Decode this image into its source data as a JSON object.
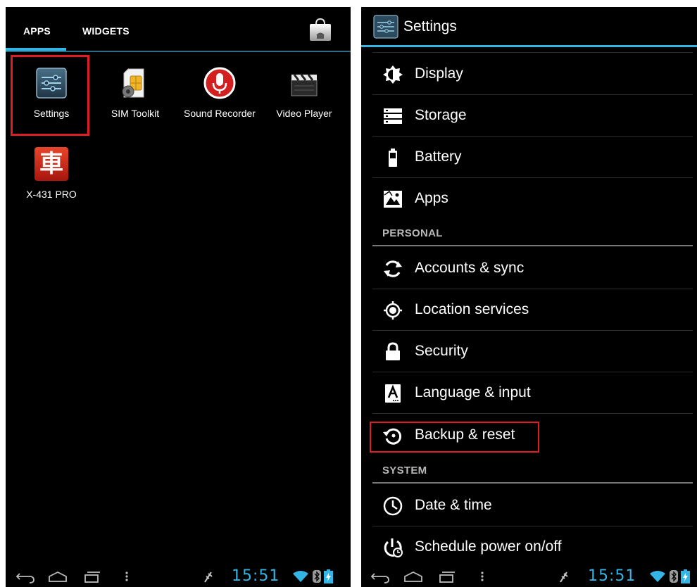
{
  "app_drawer": {
    "tabs": [
      {
        "label": "APPS"
      },
      {
        "label": "WIDGETS"
      }
    ],
    "apps": [
      {
        "label": "Settings"
      },
      {
        "label": "SIM Toolkit"
      },
      {
        "label": "Sound Recorder"
      },
      {
        "label": "Video Player"
      },
      {
        "label": "X-431 PRO"
      }
    ],
    "x431_glyph": "車"
  },
  "settings": {
    "title": "Settings",
    "items_top": [
      {
        "label": "Display",
        "icon": "display-icon"
      },
      {
        "label": "Storage",
        "icon": "storage-icon"
      },
      {
        "label": "Battery",
        "icon": "battery-icon"
      },
      {
        "label": "Apps",
        "icon": "apps-icon"
      }
    ],
    "sections": [
      {
        "header": "PERSONAL",
        "items": [
          {
            "label": "Accounts & sync",
            "icon": "sync-icon"
          },
          {
            "label": "Location services",
            "icon": "location-icon"
          },
          {
            "label": "Security",
            "icon": "lock-icon"
          },
          {
            "label": "Language & input",
            "icon": "language-icon"
          },
          {
            "label": "Backup & reset",
            "icon": "backup-icon"
          }
        ]
      },
      {
        "header": "SYSTEM",
        "items": [
          {
            "label": "Date & time",
            "icon": "clock-icon"
          },
          {
            "label": "Schedule power on/off",
            "icon": "schedule-power-icon"
          }
        ]
      }
    ]
  },
  "status_bar": {
    "time": "15:51"
  },
  "colors": {
    "accent": "#33b5e5",
    "highlight": "#e01d25",
    "background": "#000000"
  }
}
